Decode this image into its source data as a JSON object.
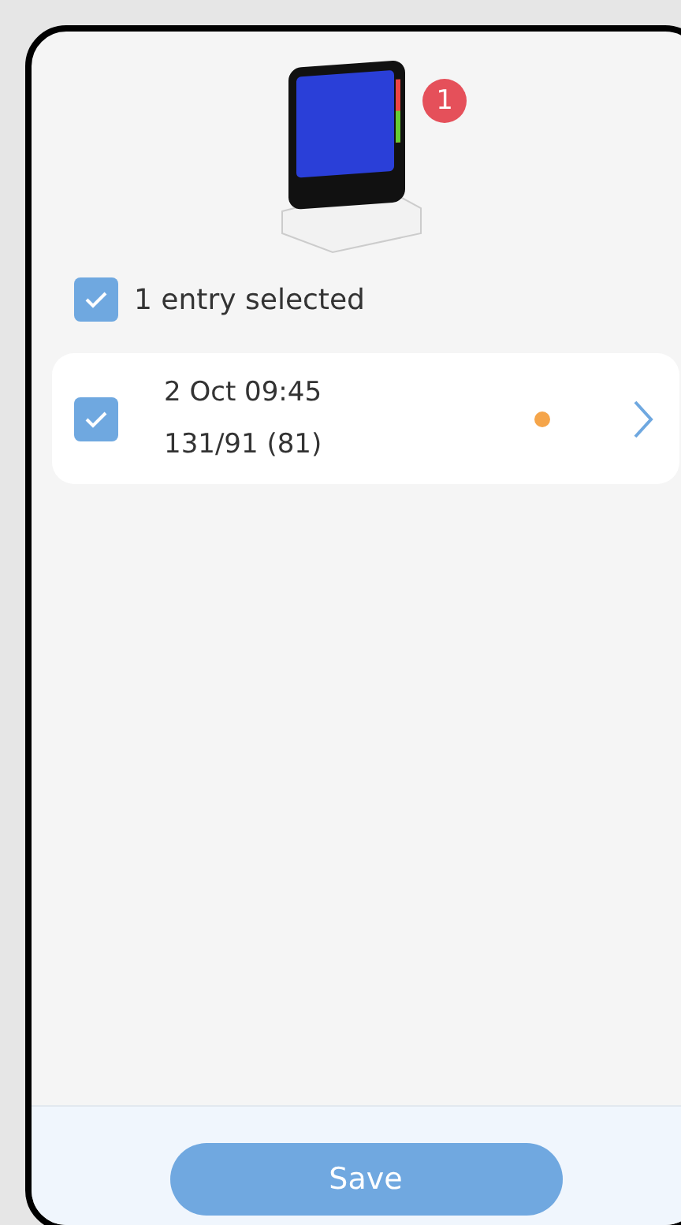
{
  "device": {
    "badge": "1"
  },
  "select_all": {
    "label": "1 entry selected",
    "checked": true
  },
  "entries": [
    {
      "date": "2 Oct 09:45",
      "reading": "131/91 (81)",
      "checked": true,
      "color": "#f5a54a"
    }
  ],
  "save_button": {
    "label": "Save"
  }
}
